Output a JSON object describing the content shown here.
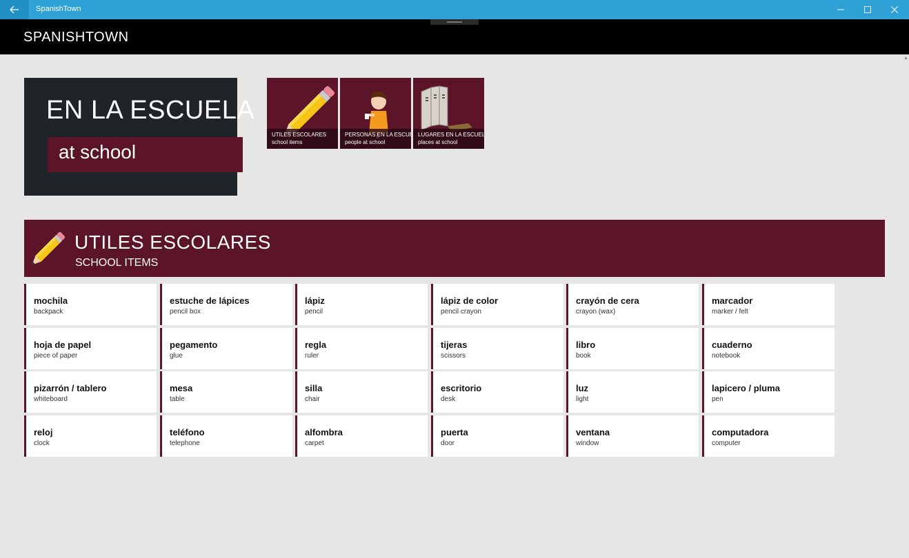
{
  "window": {
    "title": "SpanishTown",
    "back_icon": "back-arrow-icon",
    "controls": [
      "minimize-icon",
      "maximize-icon",
      "close-icon"
    ]
  },
  "header": {
    "brand": "SPANISHTOWN"
  },
  "hero": {
    "spanish": "EN LA ESCUELA",
    "english": "at school"
  },
  "tiles": [
    {
      "title": "UTILES ESCOLARES",
      "subtitle": "school items",
      "icon": "pencil-icon"
    },
    {
      "title": "PERSONAS EN LA ESCUELA",
      "subtitle": "people at school",
      "icon": "student-icon"
    },
    {
      "title": "LUGARES EN LA ESCUELA",
      "subtitle": "places at school",
      "icon": "lockers-icon"
    }
  ],
  "section": {
    "title": "UTILES ESCOLARES",
    "subtitle": "SCHOOL ITEMS",
    "icon": "pencil-icon"
  },
  "words": [
    {
      "es": "mochila",
      "en": "backpack"
    },
    {
      "es": "estuche de lápices",
      "en": "pencil box"
    },
    {
      "es": "lápiz",
      "en": "pencil"
    },
    {
      "es": "lápiz de color",
      "en": "pencil crayon"
    },
    {
      "es": "crayón de cera",
      "en": "crayon (wax)"
    },
    {
      "es": "marcador",
      "en": "marker / felt"
    },
    {
      "es": "hoja de papel",
      "en": "piece of paper"
    },
    {
      "es": "pegamento",
      "en": "glue"
    },
    {
      "es": "regla",
      "en": "ruler"
    },
    {
      "es": "tijeras",
      "en": "scissors"
    },
    {
      "es": "libro",
      "en": "book"
    },
    {
      "es": "cuaderno",
      "en": "notebook"
    },
    {
      "es": "pizarrón / tablero",
      "en": "whiteboard"
    },
    {
      "es": "mesa",
      "en": "table"
    },
    {
      "es": "silla",
      "en": "chair"
    },
    {
      "es": "escritorio",
      "en": "desk"
    },
    {
      "es": "luz",
      "en": "light"
    },
    {
      "es": "lapicero / pluma",
      "en": "pen"
    },
    {
      "es": "reloj",
      "en": "clock"
    },
    {
      "es": "teléfono",
      "en": "telephone"
    },
    {
      "es": "alfombra",
      "en": "carpet"
    },
    {
      "es": "puerta",
      "en": "door"
    },
    {
      "es": "ventana",
      "en": "window"
    },
    {
      "es": "computadora",
      "en": "computer"
    }
  ],
  "colors": {
    "titlebar": "#2ea1d6",
    "accent": "#5b1428",
    "hero": "#1f2429",
    "page": "#e6e6e6"
  }
}
